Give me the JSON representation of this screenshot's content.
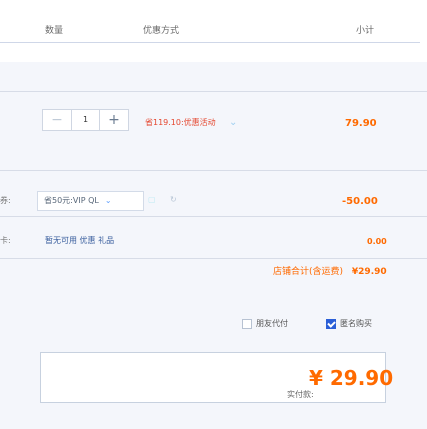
{
  "header": {
    "qty_label": "数量",
    "promo_label": "优惠方式",
    "subtotal_label": "小计"
  },
  "item": {
    "quantity": "1",
    "promotion": "省119.10:优惠活动",
    "price": "79.90"
  },
  "coupon": {
    "label": "券:",
    "selected": "省50元:VIP QL",
    "discount": "-50.00"
  },
  "gift": {
    "label": "卡:",
    "text": "暂无可用 优惠 礼品",
    "amount": "0.00"
  },
  "total": {
    "label": "店铺合计(含运费)",
    "value": "¥29.90"
  },
  "options": [
    {
      "label": "朋友代付",
      "checked": false
    },
    {
      "label": "匿名购买",
      "checked": true
    }
  ],
  "payment": {
    "label": "实付款:",
    "amount": "¥ 29.90"
  },
  "colors": {
    "accent": "#ff6a00",
    "link_blue": "#2b5fd7",
    "muted_blue": "#6a7b90"
  },
  "icons": {
    "minus": "minus-icon",
    "plus": "plus-icon",
    "chevron": "chevron-down-icon",
    "coupon": "ticket-icon",
    "refresh": "refresh-icon",
    "checkbox": "checkbox-icon"
  }
}
